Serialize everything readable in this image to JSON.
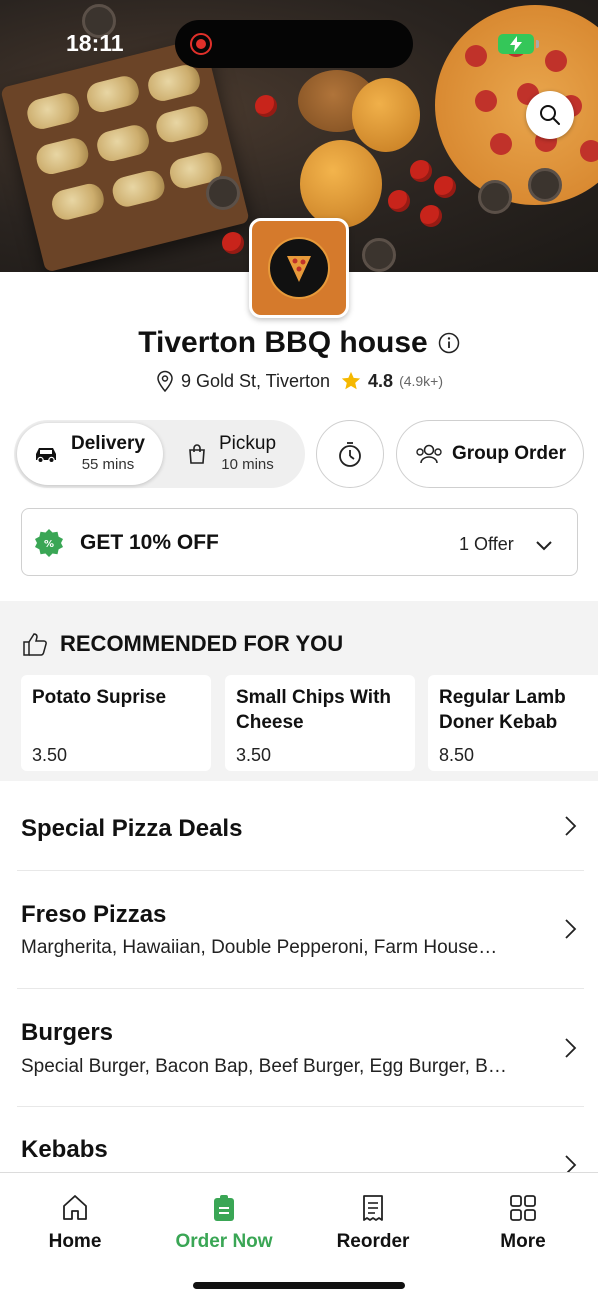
{
  "status_bar": {
    "time": "18:11"
  },
  "restaurant": {
    "name": "Tiverton BBQ house",
    "address": "9 Gold St, Tiverton",
    "rating": "4.8",
    "rating_count": "(4.9k+)"
  },
  "order_mode": {
    "delivery": {
      "label": "Delivery",
      "time": "55 mins"
    },
    "pickup": {
      "label": "Pickup",
      "time": "10 mins"
    },
    "selected": "delivery",
    "group_order_label": "Group Order"
  },
  "offer": {
    "title": "GET 10% OFF",
    "count_label": "1 Offer"
  },
  "recommended": {
    "heading": "RECOMMENDED FOR YOU",
    "items": [
      {
        "name": "Potato Suprise",
        "price": "3.50"
      },
      {
        "name": "Small Chips With Cheese",
        "price": "3.50"
      },
      {
        "name": "Regular Lamb Doner Kebab",
        "price": "8.50"
      }
    ]
  },
  "categories": [
    {
      "title": "Special Pizza Deals",
      "subtitle": ""
    },
    {
      "title": "Freso Pizzas",
      "subtitle": "Margherita, Hawaiian, Double Pepperoni, Farm House…"
    },
    {
      "title": "Burgers",
      "subtitle": "Special Burger, Bacon Bap, Beef Burger, Egg Burger, B…"
    },
    {
      "title": "Kebabs",
      "subtitle": ""
    }
  ],
  "tabbar": {
    "items": [
      {
        "label": "Home",
        "icon": "home-icon"
      },
      {
        "label": "Order Now",
        "icon": "order-bag-icon"
      },
      {
        "label": "Reorder",
        "icon": "receipt-icon"
      },
      {
        "label": "More",
        "icon": "grid-icon"
      }
    ],
    "active": "Order Now"
  },
  "colors": {
    "accent_green": "#3aa655",
    "logo_orange": "#d57a2c",
    "star_yellow": "#f5b800"
  }
}
